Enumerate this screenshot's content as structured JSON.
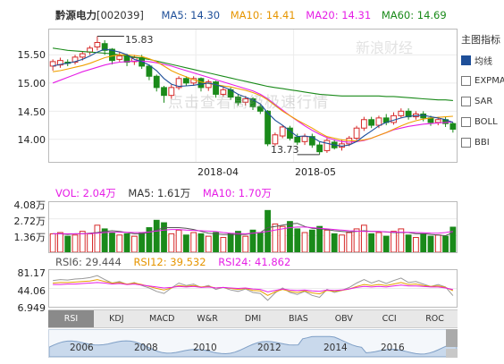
{
  "header": {
    "name": "黔源电力",
    "code": "[002039]",
    "ma5": "MA5: 14.30",
    "ma10": "MA10: 14.41",
    "ma20": "MA20: 14.31",
    "ma60": "MA60: 14.69"
  },
  "colors": {
    "ma5": "#1e4f99",
    "ma10": "#f0a000",
    "ma20": "#e61ee6",
    "ma60": "#1a8a1a",
    "up": "#d62a2a",
    "down": "#1a8a1a"
  },
  "watermark": "点击查看高级极速行情",
  "watermark2": "新浪财经",
  "side": {
    "title": "主图指标",
    "items": [
      {
        "label": "均线",
        "checked": true
      },
      {
        "label": "EXPMA",
        "checked": false
      },
      {
        "label": "SAR",
        "checked": false
      },
      {
        "label": "BOLL",
        "checked": false
      },
      {
        "label": "BBI",
        "checked": false
      }
    ]
  },
  "price_axis": [
    "15.50",
    "15.00",
    "14.50",
    "14.00"
  ],
  "date_labels": [
    "2018-04",
    "2018-05"
  ],
  "annotations": {
    "high": "15.83",
    "low": "13.73"
  },
  "volume": {
    "vol": "VOL: 2.04万",
    "ma5": "MA5: 1.61万",
    "ma10": "MA10: 1.70万",
    "axis": [
      "4.08万",
      "2.72万",
      "1.36万"
    ]
  },
  "rsi": {
    "rsi6": "RSI6: 29.444",
    "rsi12": "RSI12: 39.532",
    "rsi24": "RSI24: 41.862",
    "axis": [
      "81.17",
      "44.06",
      "6.949"
    ]
  },
  "tabs": [
    "RSI",
    "KDJ",
    "MACD",
    "W&R",
    "DMI",
    "BIAS",
    "OBV",
    "CCI",
    "ROC"
  ],
  "timeline": [
    "2006",
    "2008",
    "2010",
    "2012",
    "2014",
    "2016"
  ],
  "chart_data": [
    {
      "type": "candlestick",
      "ylim": [
        13.6,
        15.95
      ],
      "series": [
        {
          "name": "MA5"
        },
        {
          "name": "MA10"
        },
        {
          "name": "MA20"
        },
        {
          "name": "MA60"
        }
      ],
      "candles": [
        [
          15.3,
          15.38,
          15.22,
          15.42
        ],
        [
          15.32,
          15.4,
          15.27,
          15.45
        ],
        [
          15.37,
          15.35,
          15.3,
          15.42
        ],
        [
          15.37,
          15.46,
          15.33,
          15.5
        ],
        [
          15.46,
          15.52,
          15.4,
          15.56
        ],
        [
          15.55,
          15.62,
          15.5,
          15.66
        ],
        [
          15.64,
          15.72,
          15.58,
          15.83
        ],
        [
          15.7,
          15.58,
          15.5,
          15.76
        ],
        [
          15.6,
          15.4,
          15.33,
          15.62
        ],
        [
          15.42,
          15.48,
          15.38,
          15.55
        ],
        [
          15.48,
          15.37,
          15.3,
          15.52
        ],
        [
          15.38,
          15.45,
          15.32,
          15.5
        ],
        [
          15.45,
          15.3,
          15.25,
          15.5
        ],
        [
          15.3,
          15.12,
          15.05,
          15.33
        ],
        [
          15.12,
          14.92,
          14.85,
          15.15
        ],
        [
          14.92,
          14.78,
          14.65,
          14.95
        ],
        [
          14.78,
          14.92,
          14.72,
          14.97
        ],
        [
          14.92,
          15.08,
          14.88,
          15.12
        ],
        [
          15.08,
          15.0,
          14.95,
          15.12
        ],
        [
          15.0,
          15.08,
          14.95,
          15.12
        ],
        [
          15.08,
          14.92,
          14.85,
          15.1
        ],
        [
          14.92,
          15.02,
          14.86,
          15.06
        ],
        [
          15.02,
          14.8,
          14.74,
          15.04
        ],
        [
          14.8,
          14.88,
          14.76,
          14.92
        ],
        [
          14.88,
          14.75,
          14.7,
          14.92
        ],
        [
          14.75,
          14.65,
          14.6,
          14.8
        ],
        [
          14.66,
          14.72,
          14.6,
          14.77
        ],
        [
          14.72,
          14.58,
          14.52,
          14.75
        ],
        [
          14.58,
          14.5,
          14.45,
          14.62
        ],
        [
          14.5,
          13.92,
          13.88,
          14.52
        ],
        [
          13.92,
          14.08,
          13.88,
          14.12
        ],
        [
          14.06,
          14.22,
          14.02,
          14.25
        ],
        [
          14.2,
          14.02,
          13.98,
          14.24
        ],
        [
          14.04,
          13.95,
          13.9,
          14.1
        ],
        [
          13.96,
          14.05,
          13.9,
          14.1
        ],
        [
          14.05,
          13.9,
          13.85,
          14.1
        ],
        [
          13.9,
          13.78,
          13.73,
          13.95
        ],
        [
          13.8,
          13.98,
          13.76,
          14.02
        ],
        [
          13.95,
          13.85,
          13.82,
          14.0
        ],
        [
          13.86,
          13.92,
          13.8,
          14.0
        ],
        [
          13.92,
          14.02,
          13.88,
          14.06
        ],
        [
          14.02,
          14.2,
          13.98,
          14.24
        ],
        [
          14.2,
          14.35,
          14.15,
          14.4
        ],
        [
          14.35,
          14.25,
          14.2,
          14.4
        ],
        [
          14.25,
          14.38,
          14.2,
          14.42
        ],
        [
          14.38,
          14.3,
          14.25,
          14.45
        ],
        [
          14.3,
          14.42,
          14.26,
          14.48
        ],
        [
          14.42,
          14.5,
          14.38,
          14.55
        ],
        [
          14.5,
          14.4,
          14.35,
          14.55
        ],
        [
          14.4,
          14.45,
          14.35,
          14.5
        ],
        [
          14.45,
          14.38,
          14.32,
          14.5
        ],
        [
          14.38,
          14.3,
          14.24,
          14.42
        ],
        [
          14.3,
          14.35,
          14.25,
          14.4
        ],
        [
          14.35,
          14.28,
          14.22,
          14.4
        ],
        [
          14.28,
          14.18,
          14.12,
          14.3
        ]
      ],
      "ma5": [
        15.3,
        15.33,
        15.35,
        15.38,
        15.42,
        15.48,
        15.55,
        15.6,
        15.58,
        15.55,
        15.5,
        15.42,
        15.38,
        15.32,
        15.22,
        15.08,
        14.98,
        14.94,
        14.95,
        14.96,
        14.98,
        15.0,
        14.97,
        14.93,
        14.88,
        14.8,
        14.75,
        14.7,
        14.63,
        14.47,
        14.34,
        14.25,
        14.15,
        14.05,
        14.06,
        14.04,
        13.96,
        13.93,
        13.9,
        13.88,
        13.9,
        13.96,
        14.06,
        14.15,
        14.24,
        14.3,
        14.34,
        14.38,
        14.41,
        14.42,
        14.43,
        14.4,
        14.38,
        14.35,
        14.3
      ],
      "ma10": [
        15.2,
        15.22,
        15.25,
        15.28,
        15.31,
        15.35,
        15.4,
        15.45,
        15.48,
        15.5,
        15.5,
        15.49,
        15.47,
        15.43,
        15.38,
        15.3,
        15.22,
        15.16,
        15.11,
        15.06,
        15.02,
        14.99,
        14.97,
        14.95,
        14.93,
        14.9,
        14.87,
        14.83,
        14.78,
        14.7,
        14.6,
        14.5,
        14.42,
        14.34,
        14.27,
        14.2,
        14.12,
        14.05,
        14.02,
        13.99,
        13.98,
        13.97,
        13.99,
        14.02,
        14.07,
        14.12,
        14.18,
        14.24,
        14.29,
        14.33,
        14.36,
        14.38,
        14.39,
        14.4,
        14.41
      ],
      "ma20": [
        15.0,
        15.05,
        15.1,
        15.15,
        15.2,
        15.24,
        15.28,
        15.32,
        15.35,
        15.37,
        15.38,
        15.39,
        15.39,
        15.38,
        15.36,
        15.33,
        15.3,
        15.26,
        15.22,
        15.18,
        15.14,
        15.1,
        15.06,
        15.02,
        14.98,
        14.94,
        14.9,
        14.86,
        14.8,
        14.72,
        14.62,
        14.52,
        14.42,
        14.33,
        14.24,
        14.16,
        14.09,
        14.03,
        13.99,
        13.96,
        13.95,
        13.96,
        13.98,
        14.02,
        14.07,
        14.12,
        14.17,
        14.2,
        14.23,
        14.25,
        14.27,
        14.28,
        14.29,
        14.3,
        14.31
      ],
      "ma60": [
        15.62,
        15.6,
        15.58,
        15.57,
        15.56,
        15.55,
        15.54,
        15.53,
        15.52,
        15.5,
        15.48,
        15.46,
        15.44,
        15.42,
        15.39,
        15.36,
        15.33,
        15.3,
        15.27,
        15.24,
        15.21,
        15.18,
        15.15,
        15.12,
        15.09,
        15.06,
        15.03,
        15.0,
        14.97,
        14.94,
        14.92,
        14.9,
        14.88,
        14.86,
        14.84,
        14.82,
        14.8,
        14.79,
        14.78,
        14.77,
        14.77,
        14.77,
        14.77,
        14.77,
        14.77,
        14.76,
        14.76,
        14.75,
        14.74,
        14.73,
        14.72,
        14.71,
        14.7,
        14.7,
        14.69
      ]
    },
    {
      "type": "bar",
      "ylim": [
        0,
        4.08
      ],
      "values": [
        1.5,
        1.6,
        1.3,
        1.4,
        1.7,
        1.5,
        2.2,
        1.9,
        1.6,
        1.4,
        1.5,
        1.3,
        1.6,
        2.0,
        2.6,
        2.4,
        1.5,
        1.8,
        1.4,
        1.6,
        1.5,
        1.3,
        1.6,
        1.2,
        1.5,
        1.7,
        1.3,
        1.8,
        1.6,
        3.4,
        2.3,
        2.1,
        2.5,
        1.9,
        1.6,
        1.8,
        2.1,
        1.8,
        1.5,
        1.4,
        1.6,
        1.9,
        2.2,
        1.5,
        1.6,
        1.3,
        1.7,
        1.9,
        1.4,
        1.2,
        1.5,
        1.3,
        1.4,
        1.3,
        2.04
      ],
      "ma5": [
        1.5,
        1.5,
        1.45,
        1.5,
        1.5,
        1.55,
        1.6,
        1.7,
        1.75,
        1.7,
        1.6,
        1.5,
        1.5,
        1.6,
        1.8,
        2.0,
        2.0,
        2.0,
        1.95,
        1.85,
        1.7,
        1.55,
        1.5,
        1.45,
        1.45,
        1.45,
        1.45,
        1.55,
        1.6,
        2.0,
        2.1,
        2.2,
        2.3,
        2.35,
        2.1,
        1.95,
        1.9,
        1.85,
        1.75,
        1.7,
        1.65,
        1.7,
        1.75,
        1.7,
        1.7,
        1.65,
        1.6,
        1.6,
        1.6,
        1.5,
        1.5,
        1.45,
        1.4,
        1.35,
        1.61
      ],
      "ma10": [
        1.5,
        1.5,
        1.5,
        1.5,
        1.5,
        1.52,
        1.55,
        1.6,
        1.62,
        1.62,
        1.62,
        1.6,
        1.6,
        1.65,
        1.72,
        1.8,
        1.85,
        1.85,
        1.8,
        1.78,
        1.75,
        1.72,
        1.68,
        1.6,
        1.55,
        1.52,
        1.5,
        1.55,
        1.6,
        1.7,
        1.8,
        1.9,
        2.0,
        2.05,
        2.05,
        2.0,
        1.95,
        1.9,
        1.85,
        1.8,
        1.75,
        1.72,
        1.7,
        1.7,
        1.68,
        1.66,
        1.64,
        1.63,
        1.62,
        1.6,
        1.58,
        1.56,
        1.55,
        1.6,
        1.7
      ]
    },
    {
      "type": "line",
      "ylim": [
        6.949,
        81.17
      ],
      "series": [
        {
          "name": "RSI6",
          "values": [
            60,
            62,
            61,
            63,
            64,
            66,
            70,
            62,
            55,
            58,
            52,
            56,
            50,
            45,
            38,
            34,
            45,
            55,
            50,
            53,
            46,
            50,
            42,
            46,
            41,
            38,
            43,
            36,
            34,
            20,
            35,
            45,
            36,
            32,
            38,
            30,
            26,
            42,
            36,
            40,
            46,
            55,
            62,
            55,
            60,
            54,
            60,
            65,
            56,
            58,
            53,
            48,
            52,
            47,
            29.444
          ]
        },
        {
          "name": "RSI12",
          "values": [
            55,
            56,
            56,
            57,
            58,
            59,
            62,
            58,
            55,
            56,
            53,
            55,
            52,
            48,
            44,
            41,
            45,
            50,
            48,
            50,
            47,
            48,
            45,
            46,
            44,
            42,
            44,
            40,
            39,
            30,
            37,
            42,
            38,
            36,
            39,
            35,
            33,
            40,
            38,
            40,
            43,
            48,
            52,
            50,
            52,
            50,
            53,
            56,
            52,
            53,
            50,
            48,
            49,
            46,
            39.532
          ]
        },
        {
          "name": "RSI24",
          "values": [
            52,
            52,
            53,
            53,
            54,
            55,
            56,
            55,
            53,
            54,
            52,
            53,
            51,
            49,
            47,
            45,
            46,
            48,
            47,
            48,
            46,
            47,
            45,
            46,
            45,
            44,
            45,
            43,
            42,
            37,
            40,
            43,
            41,
            40,
            41,
            39,
            38,
            41,
            40,
            41,
            43,
            46,
            48,
            47,
            48,
            47,
            49,
            51,
            49,
            49,
            48,
            47,
            47,
            45,
            41.862
          ]
        }
      ]
    }
  ]
}
